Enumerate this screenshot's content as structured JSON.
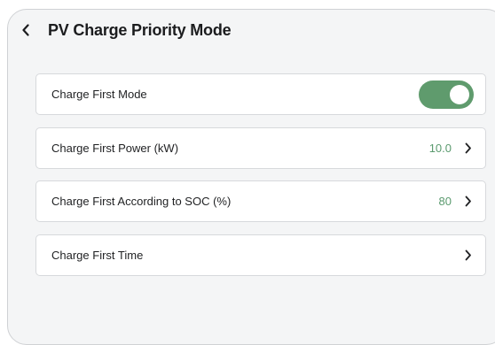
{
  "header": {
    "title": "PV Charge Priority Mode",
    "back_icon": "chevron-left-icon"
  },
  "settings": {
    "charge_first_mode": {
      "label": "Charge First Mode",
      "enabled": true,
      "toggle_color": "#5f9b6d"
    },
    "charge_first_power": {
      "label": "Charge First Power (kW)",
      "value": "10.0"
    },
    "charge_first_soc": {
      "label": "Charge First According to SOC (%)",
      "value": "80"
    },
    "charge_first_time": {
      "label": "Charge First Time"
    }
  },
  "colors": {
    "accent": "#5a9a6e",
    "background": "#f4f5f6"
  }
}
